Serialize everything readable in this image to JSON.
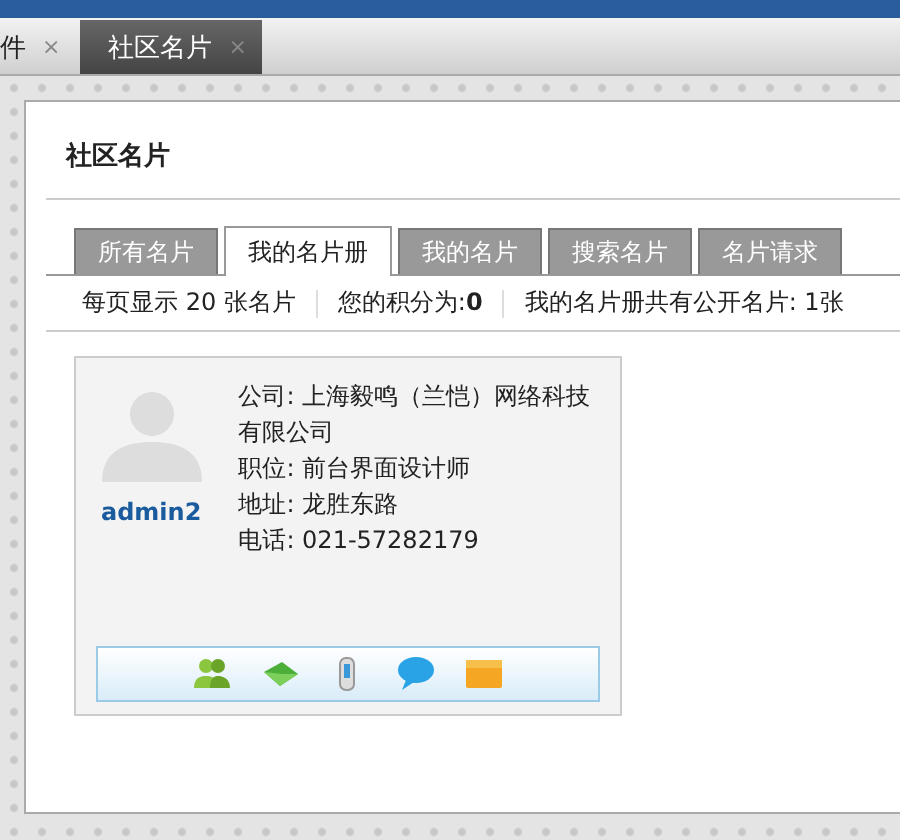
{
  "window_tabs": [
    {
      "label": "件",
      "close": "×",
      "selected": false
    },
    {
      "label": "社区名片",
      "close": "×",
      "selected": true
    }
  ],
  "panel": {
    "title": "社区名片",
    "tabs": [
      {
        "label": "所有名片",
        "selected": false
      },
      {
        "label": "我的名片册",
        "selected": true
      },
      {
        "label": "我的名片",
        "selected": false
      },
      {
        "label": "搜索名片",
        "selected": false
      },
      {
        "label": "名片请求",
        "selected": false
      }
    ],
    "info": [
      "每页显示 20 张名片",
      "您的积分为:**0**",
      "我的名片册共有公开名片: 1张"
    ],
    "cards": [
      {
        "name": "admin2",
        "fields": [
          "公司:  上海毅鸣（兰恺）网络科技有限公司",
          "职位:  前台界面设计师",
          "地址:  龙胜东路",
          "电话:  021-57282179"
        ],
        "actions": [
          {
            "kind": "friends"
          },
          {
            "kind": "mail"
          },
          {
            "kind": "phone"
          },
          {
            "kind": "chat"
          },
          {
            "kind": "folder"
          }
        ]
      }
    ]
  }
}
